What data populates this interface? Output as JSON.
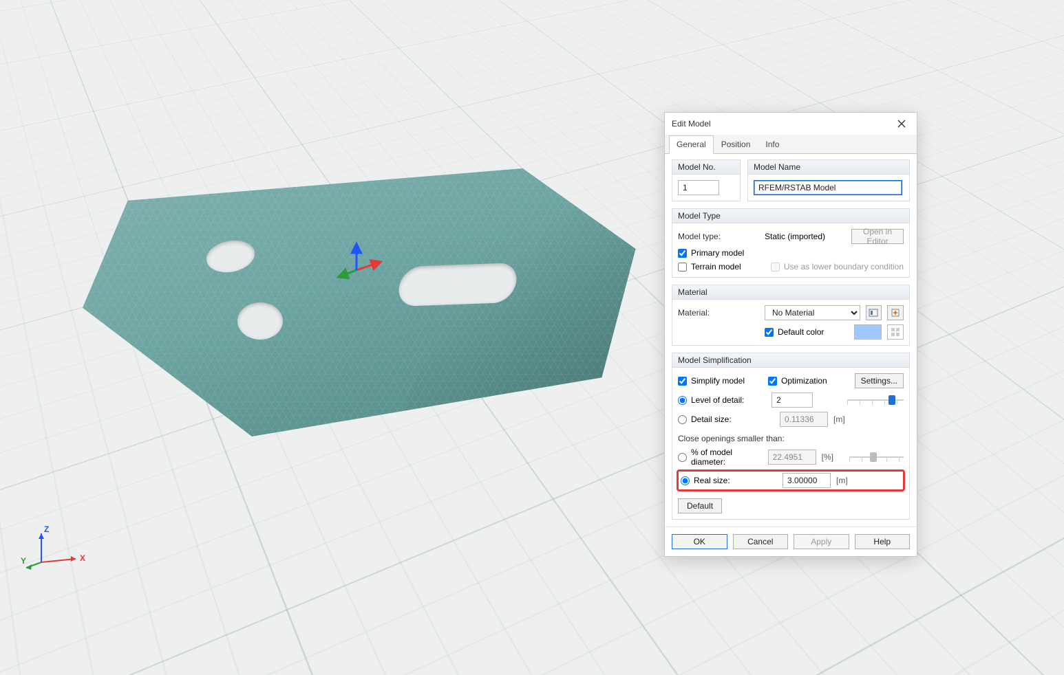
{
  "axes": {
    "x": "X",
    "y": "Y",
    "z": "Z"
  },
  "dialog": {
    "title": "Edit Model",
    "tabs": {
      "general": "General",
      "position": "Position",
      "info": "Info"
    },
    "model_no": {
      "header": "Model No.",
      "value": "1"
    },
    "model_name": {
      "header": "Model Name",
      "value": "RFEM/RSTAB Model"
    },
    "model_type": {
      "header": "Model Type",
      "type_label": "Model type:",
      "type_value": "Static (imported)",
      "open_editor": "Open in Editor",
      "primary": "Primary model",
      "terrain": "Terrain model",
      "lower_boundary": "Use as lower boundary condition"
    },
    "material": {
      "header": "Material",
      "label": "Material:",
      "value": "No Material",
      "default_color": "Default color"
    },
    "simpl": {
      "header": "Model Simplification",
      "simplify": "Simplify model",
      "optimization": "Optimization",
      "settings": "Settings...",
      "lod": "Level of detail:",
      "lod_value": "2",
      "detail": "Detail size:",
      "detail_value": "0.11336",
      "detail_unit": "[m]",
      "close_label": "Close openings smaller than:",
      "pct_label": "% of model diameter:",
      "pct_value": "22.4951",
      "pct_unit": "[%]",
      "real_label": "Real size:",
      "real_value": "3.00000",
      "real_unit": "[m]",
      "default_btn": "Default"
    },
    "footer": {
      "ok": "OK",
      "cancel": "Cancel",
      "apply": "Apply",
      "help": "Help"
    }
  }
}
